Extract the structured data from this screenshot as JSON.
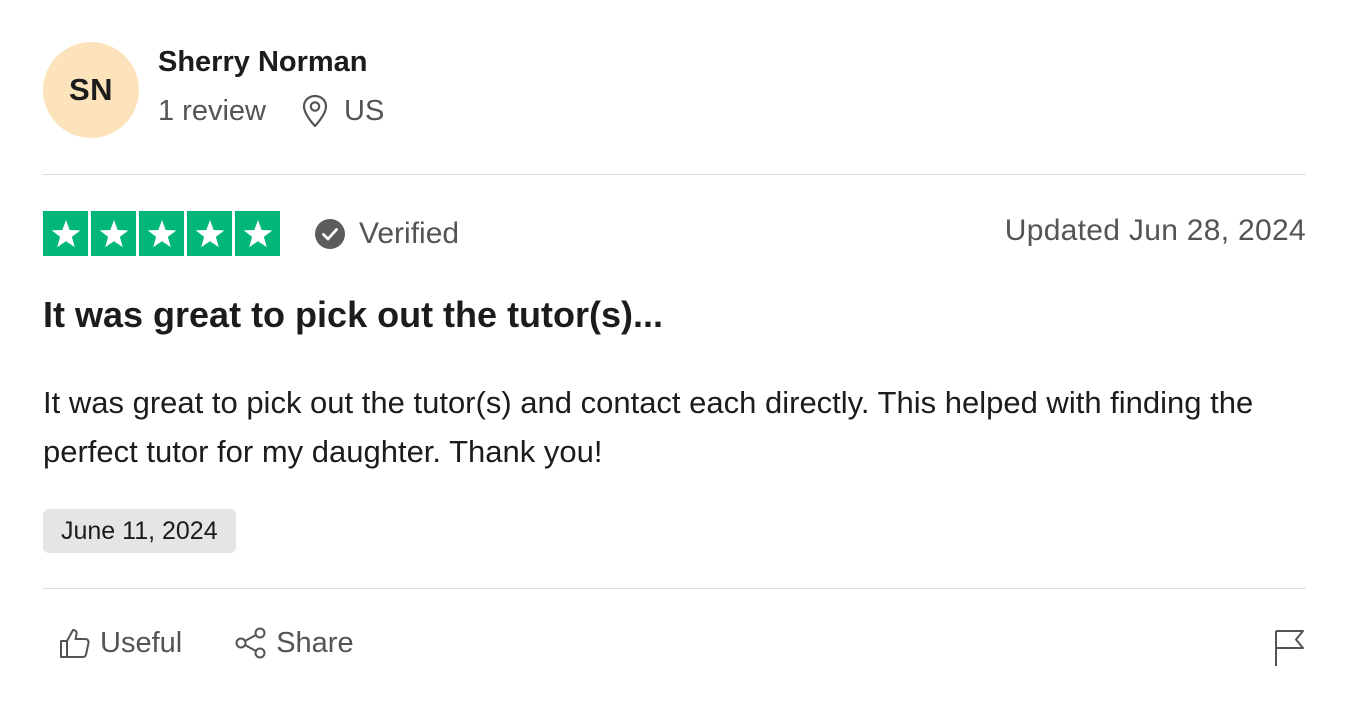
{
  "reviewer": {
    "initials": "SN",
    "name": "Sherry Norman",
    "review_count": "1 review",
    "country": "US",
    "avatar_color": "#fde3bb"
  },
  "rating": {
    "stars": 5,
    "max_stars": 5,
    "star_color": "#00b67a",
    "verified_label": "Verified"
  },
  "updated_label": "Updated Jun 28, 2024",
  "review": {
    "title": "It was great to pick out the tutor(s)...",
    "body": "It was great to pick out the tutor(s) and contact each directly. This helped with finding the perfect tutor for my daughter. Thank you!",
    "experience_date": "June 11, 2024"
  },
  "actions": {
    "useful_label": "Useful",
    "share_label": "Share"
  },
  "icons": {
    "location": "location-pin-icon",
    "verified": "check-circle-icon",
    "star": "star-icon",
    "useful": "thumbs-up-icon",
    "share": "share-icon",
    "report": "flag-icon"
  }
}
